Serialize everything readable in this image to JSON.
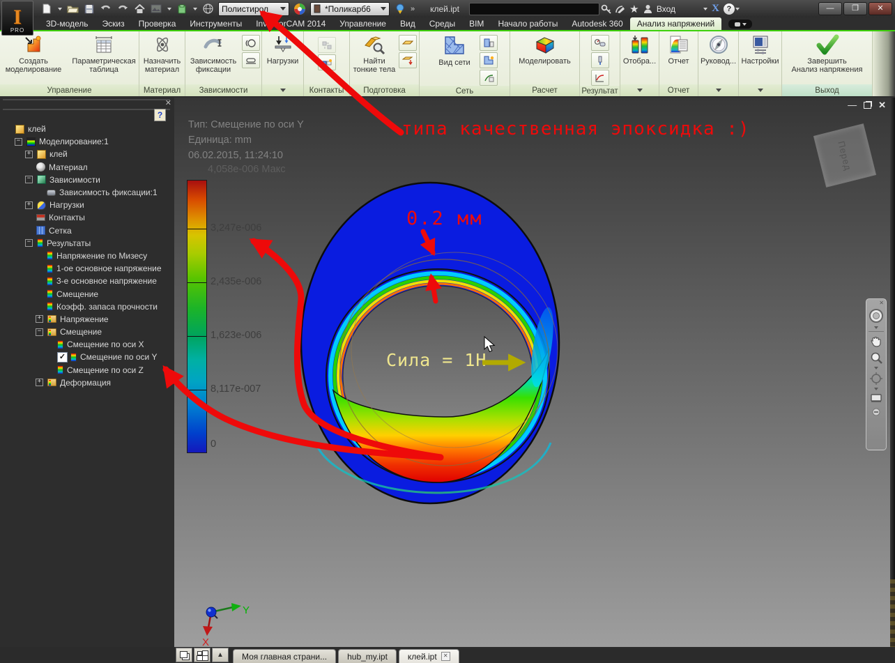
{
  "titlebar": {
    "logo_text": "PRO",
    "material_combo": "Полистирол",
    "appearance_combo": "*Поликарб6",
    "doc_title": "клей.ipt",
    "signin_label": "Вход",
    "exchange_label": "X",
    "help_label": "?",
    "minimize": "—",
    "restore": "❐",
    "close": "✕"
  },
  "ribbon_tabs": {
    "items": [
      {
        "label": "3D-модель",
        "active": false
      },
      {
        "label": "Эскиз",
        "active": false
      },
      {
        "label": "Проверка",
        "active": false
      },
      {
        "label": "Инструменты",
        "active": false
      },
      {
        "label": "InventorCAM 2014",
        "active": false
      },
      {
        "label": "Управление",
        "active": false
      },
      {
        "label": "Вид",
        "active": false
      },
      {
        "label": "Среды",
        "active": false
      },
      {
        "label": "BIM",
        "active": false
      },
      {
        "label": "Начало работы",
        "active": false
      },
      {
        "label": "Autodesk 360",
        "active": false
      },
      {
        "label": "Анализ напряжений",
        "active": true
      }
    ]
  },
  "ribbon": {
    "buttons": {
      "create_sim": "Создать\nмоделирование",
      "param_table": "Параметрическая\nтаблица",
      "assign_material": "Назначить\nматериал",
      "fix_constraint": "Зависимость\nфиксации",
      "loads": "Нагрузки",
      "find_thin": "Найти\nтонкие тела",
      "mesh_view": "Вид сети",
      "simulate": "Моделировать",
      "display": "Отобра...",
      "report": "Отчет",
      "guide": "Руковод...",
      "settings": "Настройки",
      "finish": "Завершить\nАнализ напряжения"
    },
    "panel_labels": {
      "manage": "Управление",
      "material": "Материал",
      "constraints": "Зависимости",
      "contacts": "Контакты",
      "prepare": "Подготовка",
      "mesh": "Сеть",
      "solve": "Расчет",
      "result": "Результат",
      "report": "Отчет",
      "exit": "Выход"
    }
  },
  "browser": {
    "help_label": "?",
    "tree": [
      {
        "label": "клей",
        "level": 0,
        "icon": "part",
        "expander": "none"
      },
      {
        "label": "Моделирование:1",
        "level": 1,
        "icon": "sim",
        "expander": "minus"
      },
      {
        "label": "клей",
        "level": 2,
        "icon": "part",
        "expander": "plus"
      },
      {
        "label": "Материал",
        "level": 2,
        "icon": "material",
        "expander": "none"
      },
      {
        "label": "Зависимости",
        "level": 2,
        "icon": "constraints",
        "expander": "minus"
      },
      {
        "label": "Зависимость фиксации:1",
        "level": 3,
        "icon": "fixture",
        "expander": "none"
      },
      {
        "label": "Нагрузки",
        "level": 2,
        "icon": "loads",
        "expander": "plus"
      },
      {
        "label": "Контакты",
        "level": 2,
        "icon": "contacts",
        "expander": "none"
      },
      {
        "label": "Сетка",
        "level": 2,
        "icon": "mesh",
        "expander": "none"
      },
      {
        "label": "Результаты",
        "level": 2,
        "icon": "result",
        "expander": "minus"
      },
      {
        "label": "Напряжение по Мизесу",
        "level": 3,
        "icon": "result",
        "expander": "none"
      },
      {
        "label": "1-ое основное напряжение",
        "level": 3,
        "icon": "result",
        "expander": "none"
      },
      {
        "label": "3-е основное напряжение",
        "level": 3,
        "icon": "result",
        "expander": "none"
      },
      {
        "label": "Смещение",
        "level": 3,
        "icon": "result",
        "expander": "none"
      },
      {
        "label": "Коэфф. запаса прочности",
        "level": 3,
        "icon": "result",
        "expander": "none"
      },
      {
        "label": "Напряжение",
        "level": 3,
        "icon": "folder",
        "expander": "plus"
      },
      {
        "label": "Смещение",
        "level": 3,
        "icon": "folder",
        "expander": "minus"
      },
      {
        "label": "Смещение по оси X",
        "level": 4,
        "icon": "result",
        "expander": "none"
      },
      {
        "label": "Смещение по оси Y",
        "level": 4,
        "icon": "result",
        "expander": "none",
        "checked": true
      },
      {
        "label": "Смещение по оси Z",
        "level": 4,
        "icon": "result",
        "expander": "none"
      },
      {
        "label": "Деформация",
        "level": 3,
        "icon": "folder",
        "expander": "plus"
      }
    ]
  },
  "viewport": {
    "result_header": {
      "type_line": "Тип: Смещение по оси Y",
      "unit_line": "Единица: mm",
      "timestamp": "06.02.2015, 11:24:10",
      "max_label": "4,058e-006 Макс"
    },
    "legend_labels": [
      "3,247e-006",
      "2,435e-006",
      "1,623e-006",
      "8,117e-007",
      "0"
    ],
    "annotations": {
      "epoxy": "типа качественная эпоксидка :)",
      "gap": "0.2 мм",
      "force": "Сила = 1Н"
    },
    "viewcube_label": "Перед",
    "triad": {
      "x_label": "X",
      "y_label": "Y"
    }
  },
  "doc_tabs": {
    "items": [
      {
        "label": "Моя главная страни...",
        "active": false,
        "closable": false
      },
      {
        "label": "hub_my.ipt",
        "active": false,
        "closable": false
      },
      {
        "label": "клей.ipt",
        "active": true,
        "closable": true
      }
    ]
  },
  "colors": {
    "accent_red": "#ee0a0a",
    "force_yellow": "#efe68e",
    "force_arrow_olive": "#b2aa00",
    "model_blue": "#0a1ce0",
    "tab_active_green": "#e4f3d4"
  }
}
